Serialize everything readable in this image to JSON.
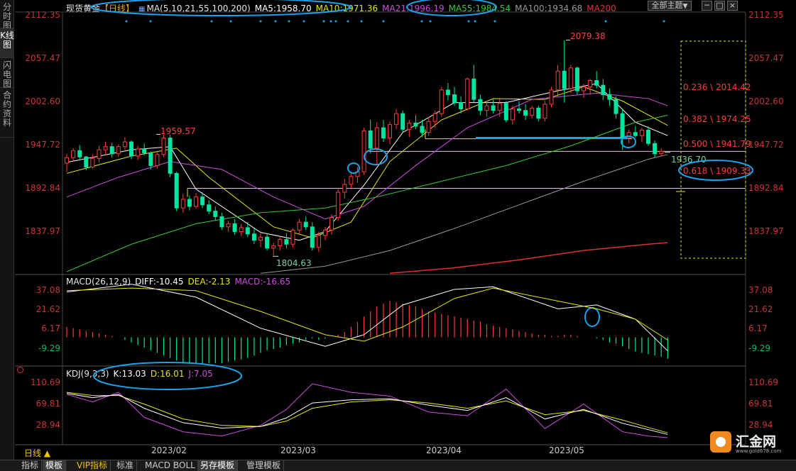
{
  "colors": {
    "up": "#ff3b3b",
    "down": "#00e5a0",
    "ma5": "#ffffff",
    "ma10": "#e6e619",
    "ma21": "#d04be0",
    "ma55": "#33cc33",
    "ma100": "#999999",
    "ma200": "#e03030",
    "axis": "#cc3333",
    "fib": "#e6e619",
    "annot": "#1aa3e8"
  },
  "side_tabs": [
    "分时图",
    "K线图",
    "闪电图",
    "合约资料"
  ],
  "legend": {
    "title": "现货黄金",
    "period": "【日线】",
    "ma_params": "MA(5,10,21,55,100,200)",
    "ma5": "MA5:1958.70",
    "ma10": "MA10:1971.36",
    "ma21": "MA21:1996.19",
    "ma55": "MA55:1984.54",
    "ma100": "MA100:1934.68",
    "ma200": "MA200"
  },
  "top_controls": {
    "theme": "全部主题",
    "theme_arrow": "▼",
    "btn_min": "─",
    "btn_max": "□",
    "btn_close": "×"
  },
  "price_axis": {
    "ticks": [
      "2112.35",
      "2057.47",
      "2002.60",
      "1947.72",
      "1892.84",
      "1837.97"
    ],
    "range": [
      1783.1,
      2112.35
    ]
  },
  "price_labels": {
    "high1": "1959.57",
    "low1": "1804.63",
    "high2": "2079.38",
    "current": "1936.70"
  },
  "fib_levels": [
    {
      "label": "0.236 \\ 2014.42",
      "price": 2014.42
    },
    {
      "label": "0.382 \\ 1974.25",
      "price": 1974.25
    },
    {
      "label": "0.500 \\ 1941.79",
      "price": 1941.79
    },
    {
      "label": "0.618 \\ 1909.33",
      "price": 1909.33
    }
  ],
  "macd_legend": {
    "params": "MACD(26,12,9)",
    "diff": "DIFF:-10.45",
    "dea": "DEA:-2.13",
    "macd": "MACD:-16.65"
  },
  "macd_axis": {
    "ticks": [
      "37.08",
      "21.62",
      "6.17",
      "-9.29"
    ],
    "range": [
      -20,
      43
    ]
  },
  "kdj_legend": {
    "params": "KDJ(9,3,3)",
    "k": "K:13.03",
    "d": "D:16.01",
    "j": "J:7.05"
  },
  "kdj_axis": {
    "ticks": [
      "110.69",
      "69.81",
      "28.94"
    ],
    "range": [
      -5,
      128
    ]
  },
  "date_axis": [
    "2023/02",
    "2023/03",
    "2023/04",
    "2023/05"
  ],
  "period_selector": "日线 ▲",
  "bottom_tabs": [
    "指标",
    "模板",
    "VIP指标",
    "标准",
    "MACD",
    "BOLL",
    "另存模板",
    "管理模板"
  ],
  "logo": {
    "name": "汇金网",
    "url": "www.gold678.com"
  },
  "chart_data": {
    "type": "candlestick",
    "ohlc": [
      [
        1923,
        1935,
        1912,
        1930
      ],
      [
        1930,
        1942,
        1925,
        1939
      ],
      [
        1939,
        1946,
        1928,
        1931
      ],
      [
        1931,
        1932,
        1914,
        1918
      ],
      [
        1918,
        1934,
        1916,
        1929
      ],
      [
        1929,
        1945,
        1924,
        1940
      ],
      [
        1940,
        1950,
        1933,
        1944
      ],
      [
        1944,
        1949,
        1930,
        1935
      ],
      [
        1935,
        1947,
        1931,
        1944
      ],
      [
        1944,
        1956,
        1940,
        1950
      ],
      [
        1950,
        1952,
        1928,
        1932
      ],
      [
        1932,
        1945,
        1927,
        1941
      ],
      [
        1941,
        1948,
        1933,
        1936
      ],
      [
        1936,
        1938,
        1915,
        1920
      ],
      [
        1920,
        1937,
        1916,
        1934
      ],
      [
        1934,
        1959,
        1931,
        1955
      ],
      [
        1955,
        1959,
        1905,
        1910
      ],
      [
        1910,
        1912,
        1862,
        1866
      ],
      [
        1866,
        1884,
        1860,
        1877
      ],
      [
        1877,
        1882,
        1863,
        1868
      ],
      [
        1868,
        1885,
        1865,
        1880
      ],
      [
        1880,
        1886,
        1866,
        1870
      ],
      [
        1870,
        1876,
        1858,
        1862
      ],
      [
        1862,
        1868,
        1850,
        1855
      ],
      [
        1855,
        1860,
        1838,
        1842
      ],
      [
        1842,
        1850,
        1836,
        1846
      ],
      [
        1846,
        1852,
        1832,
        1836
      ],
      [
        1836,
        1846,
        1830,
        1841
      ],
      [
        1841,
        1848,
        1829,
        1833
      ],
      [
        1833,
        1840,
        1820,
        1825
      ],
      [
        1825,
        1834,
        1816,
        1829
      ],
      [
        1829,
        1834,
        1812,
        1815
      ],
      [
        1815,
        1822,
        1806,
        1818
      ],
      [
        1818,
        1830,
        1812,
        1826
      ],
      [
        1826,
        1834,
        1815,
        1820
      ],
      [
        1820,
        1840,
        1816,
        1838
      ],
      [
        1838,
        1852,
        1832,
        1848
      ],
      [
        1848,
        1855,
        1838,
        1842
      ],
      [
        1842,
        1848,
        1812,
        1816
      ],
      [
        1816,
        1836,
        1810,
        1831
      ],
      [
        1831,
        1842,
        1825,
        1838
      ],
      [
        1838,
        1858,
        1832,
        1854
      ],
      [
        1854,
        1890,
        1850,
        1886
      ],
      [
        1886,
        1903,
        1878,
        1896
      ],
      [
        1896,
        1910,
        1890,
        1906
      ],
      [
        1906,
        1918,
        1898,
        1912
      ],
      [
        1912,
        1968,
        1908,
        1964
      ],
      [
        1964,
        1978,
        1935,
        1942
      ],
      [
        1942,
        1975,
        1920,
        1968
      ],
      [
        1968,
        1978,
        1950,
        1955
      ],
      [
        1955,
        1976,
        1947,
        1972
      ],
      [
        1972,
        1992,
        1966,
        1986
      ],
      [
        1986,
        1990,
        1962,
        1966
      ],
      [
        1966,
        1978,
        1956,
        1974
      ],
      [
        1974,
        1984,
        1966,
        1970
      ],
      [
        1970,
        1978,
        1956,
        1962
      ],
      [
        1962,
        1982,
        1958,
        1976
      ],
      [
        1976,
        1990,
        1968,
        1986
      ],
      [
        1986,
        2020,
        1982,
        2016
      ],
      [
        2016,
        2025,
        2003,
        2010
      ],
      [
        2010,
        2020,
        1996,
        2000
      ],
      [
        2000,
        2008,
        1986,
        1992
      ],
      [
        1992,
        2032,
        1990,
        2030
      ],
      [
        2030,
        2048,
        2000,
        2004
      ],
      [
        2004,
        2010,
        1984,
        1990
      ],
      [
        1990,
        2002,
        1982,
        1996
      ],
      [
        1996,
        2004,
        1986,
        1990
      ],
      [
        1990,
        2006,
        1982,
        1999
      ],
      [
        1999,
        2002,
        1975,
        1978
      ],
      [
        1978,
        1996,
        1972,
        1992
      ],
      [
        1992,
        2002,
        1986,
        1990
      ],
      [
        1990,
        1998,
        1978,
        1984
      ],
      [
        1984,
        1996,
        1980,
        1993
      ],
      [
        1993,
        1996,
        1976,
        1980
      ],
      [
        1980,
        2002,
        1976,
        1998
      ],
      [
        1998,
        2020,
        1994,
        2016
      ],
      [
        2016,
        2048,
        2010,
        2040
      ],
      [
        2040,
        2079,
        2000,
        2018
      ],
      [
        2018,
        2048,
        2012,
        2044
      ],
      [
        2044,
        2046,
        2010,
        2015
      ],
      [
        2015,
        2024,
        2006,
        2020
      ],
      [
        2020,
        2030,
        2010,
        2028
      ],
      [
        2028,
        2040,
        2018,
        2022
      ],
      [
        2022,
        2030,
        2003,
        2010
      ],
      [
        2010,
        2018,
        1996,
        2004
      ],
      [
        2004,
        2008,
        1980,
        1986
      ],
      [
        1986,
        1992,
        1940,
        1955
      ],
      [
        1955,
        1966,
        1948,
        1962
      ],
      [
        1962,
        1970,
        1955,
        1958
      ],
      [
        1958,
        1968,
        1950,
        1965
      ],
      [
        1965,
        1970,
        1945,
        1948
      ],
      [
        1948,
        1952,
        1930,
        1935
      ],
      [
        1935,
        1942,
        1932,
        1938
      ]
    ],
    "ma_lines": [
      {
        "name": "MA5",
        "points": [
          [
            0,
            1924
          ],
          [
            10,
            1940
          ],
          [
            16,
            1944
          ],
          [
            20,
            1890
          ],
          [
            30,
            1835
          ],
          [
            36,
            1825
          ],
          [
            40,
            1836
          ],
          [
            46,
            1895
          ],
          [
            52,
            1962
          ],
          [
            60,
            2000
          ],
          [
            68,
            2000
          ],
          [
            76,
            2015
          ],
          [
            82,
            2024
          ],
          [
            88,
            1975
          ],
          [
            93,
            1958
          ]
        ]
      },
      {
        "name": "MA10",
        "points": [
          [
            0,
            1910
          ],
          [
            10,
            1932
          ],
          [
            17,
            1942
          ],
          [
            22,
            1905
          ],
          [
            32,
            1842
          ],
          [
            38,
            1828
          ],
          [
            44,
            1848
          ],
          [
            50,
            1925
          ],
          [
            58,
            1978
          ],
          [
            66,
            2005
          ],
          [
            74,
            2004
          ],
          [
            80,
            2020
          ],
          [
            86,
            2002
          ],
          [
            93,
            1971
          ]
        ]
      },
      {
        "name": "MA21",
        "points": [
          [
            0,
            1880
          ],
          [
            8,
            1905
          ],
          [
            16,
            1925
          ],
          [
            24,
            1915
          ],
          [
            32,
            1880
          ],
          [
            40,
            1852
          ],
          [
            46,
            1868
          ],
          [
            54,
            1920
          ],
          [
            62,
            1968
          ],
          [
            72,
            2004
          ],
          [
            82,
            2012
          ],
          [
            90,
            2005
          ],
          [
            93,
            1996
          ]
        ]
      },
      {
        "name": "MA55",
        "points": [
          [
            0,
            1785
          ],
          [
            10,
            1820
          ],
          [
            20,
            1846
          ],
          [
            30,
            1860
          ],
          [
            40,
            1866
          ],
          [
            48,
            1880
          ],
          [
            58,
            1900
          ],
          [
            68,
            1920
          ],
          [
            78,
            1945
          ],
          [
            88,
            1975
          ],
          [
            93,
            1984
          ]
        ]
      },
      {
        "name": "MA100",
        "points": [
          [
            30,
            1783
          ],
          [
            40,
            1792
          ],
          [
            50,
            1812
          ],
          [
            60,
            1840
          ],
          [
            70,
            1870
          ],
          [
            80,
            1900
          ],
          [
            90,
            1928
          ],
          [
            93,
            1934
          ]
        ]
      },
      {
        "name": "MA200",
        "points": [
          [
            50,
            1783
          ],
          [
            60,
            1790
          ],
          [
            70,
            1800
          ],
          [
            80,
            1812
          ],
          [
            90,
            1820
          ],
          [
            93,
            1822
          ]
        ]
      }
    ],
    "macd": {
      "hist": [
        8,
        7,
        6,
        5,
        4,
        3,
        2,
        1,
        0,
        -2,
        -4,
        -6,
        -8,
        -10,
        -12,
        -14,
        -16,
        -18,
        -20,
        -20,
        -20,
        -20,
        -20,
        -20,
        -20,
        -19,
        -18,
        -17,
        -16,
        -14,
        -12,
        -10,
        -9,
        -8,
        -6,
        -5,
        -4,
        -2,
        -1,
        -2,
        -1,
        0,
        2,
        4,
        8,
        12,
        16,
        20,
        24,
        26,
        28,
        27,
        26,
        25,
        24,
        22,
        20,
        19,
        18,
        17,
        16,
        15,
        14,
        13,
        12,
        10,
        9,
        8,
        7,
        6,
        5,
        4,
        3,
        2,
        2,
        1,
        1,
        2,
        2,
        1,
        0,
        0,
        -1,
        -2,
        -4,
        -5,
        -7,
        -9,
        -11,
        -12,
        -13,
        -14,
        -15,
        -16.65
      ],
      "diff": [
        [
          0,
          35
        ],
        [
          10,
          41
        ],
        [
          20,
          31
        ],
        [
          30,
          7
        ],
        [
          40,
          -7
        ],
        [
          46,
          2
        ],
        [
          52,
          25
        ],
        [
          60,
          37
        ],
        [
          66,
          39
        ],
        [
          76,
          22
        ],
        [
          82,
          25
        ],
        [
          88,
          14
        ],
        [
          93,
          -10.45
        ]
      ],
      "dea": [
        [
          0,
          36
        ],
        [
          10,
          38
        ],
        [
          20,
          36
        ],
        [
          30,
          20
        ],
        [
          40,
          2
        ],
        [
          46,
          -3
        ],
        [
          52,
          8
        ],
        [
          60,
          30
        ],
        [
          66,
          38
        ],
        [
          76,
          28
        ],
        [
          82,
          22
        ],
        [
          88,
          14
        ],
        [
          93,
          -2.13
        ]
      ]
    },
    "kdj": {
      "k": [
        [
          0,
          90
        ],
        [
          4,
          82
        ],
        [
          8,
          88
        ],
        [
          12,
          62
        ],
        [
          18,
          35
        ],
        [
          24,
          25
        ],
        [
          30,
          28
        ],
        [
          34,
          44
        ],
        [
          38,
          72
        ],
        [
          44,
          78
        ],
        [
          50,
          80
        ],
        [
          56,
          68
        ],
        [
          62,
          58
        ],
        [
          68,
          82
        ],
        [
          74,
          42
        ],
        [
          80,
          60
        ],
        [
          86,
          34
        ],
        [
          90,
          22
        ],
        [
          93,
          13.03
        ]
      ],
      "d": [
        [
          0,
          92
        ],
        [
          4,
          86
        ],
        [
          8,
          86
        ],
        [
          12,
          70
        ],
        [
          18,
          42
        ],
        [
          24,
          30
        ],
        [
          30,
          28
        ],
        [
          34,
          38
        ],
        [
          38,
          62
        ],
        [
          44,
          74
        ],
        [
          50,
          78
        ],
        [
          56,
          72
        ],
        [
          62,
          62
        ],
        [
          68,
          76
        ],
        [
          74,
          50
        ],
        [
          80,
          58
        ],
        [
          86,
          40
        ],
        [
          90,
          26
        ],
        [
          93,
          16.01
        ]
      ],
      "j": [
        [
          0,
          88
        ],
        [
          4,
          74
        ],
        [
          8,
          92
        ],
        [
          12,
          45
        ],
        [
          18,
          18
        ],
        [
          24,
          10
        ],
        [
          30,
          30
        ],
        [
          34,
          60
        ],
        [
          38,
          108
        ],
        [
          44,
          92
        ],
        [
          50,
          85
        ],
        [
          56,
          55
        ],
        [
          62,
          48
        ],
        [
          68,
          98
        ],
        [
          74,
          24
        ],
        [
          80,
          70
        ],
        [
          86,
          18
        ],
        [
          90,
          10
        ],
        [
          93,
          7.05
        ]
      ]
    }
  }
}
